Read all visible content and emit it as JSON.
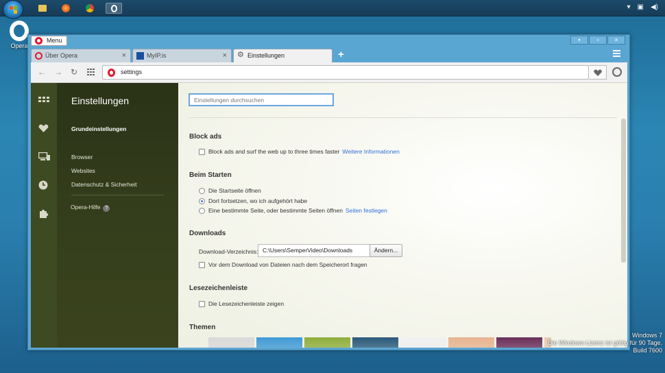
{
  "taskbar": {
    "apps": [
      {
        "name": "explorer",
        "color": "#e8c45a"
      },
      {
        "name": "firefox",
        "color": "#e35a1f"
      },
      {
        "name": "chrome",
        "color": "#4caf50"
      },
      {
        "name": "opera",
        "color": "#ffffff"
      }
    ]
  },
  "desktop": {
    "icon_label": "Opera"
  },
  "window": {
    "menu_label": "Menu",
    "controls": {
      "minimize": "▪",
      "maximize": "▫",
      "close": "×"
    }
  },
  "tabs": [
    {
      "label": "Über Opera",
      "close": "×"
    },
    {
      "label": "MyIP.is",
      "close": "×"
    },
    {
      "label": "Einstellungen",
      "close": ""
    }
  ],
  "newtab_label": "+",
  "navbar": {
    "back": "←",
    "forward": "→",
    "reload": "↻",
    "address": "settings"
  },
  "sidebar_nav": {
    "title": "Einstellungen",
    "items": [
      "Grundeinstellungen",
      "Browser",
      "Websites",
      "Datenschutz & Sicherheit"
    ],
    "help": "Opera-Hilfe",
    "help_badge": "?"
  },
  "settings": {
    "search_placeholder": "Einstellungen durchsuchen",
    "block_ads": {
      "title": "Block ads",
      "checkbox": "Block ads and surf the web up to three times faster",
      "link": "Weitere Informationen"
    },
    "startup": {
      "title": "Beim Starten",
      "options": [
        "Die Startseite öffnen",
        "Dort fortsetzen, wo ich aufgehört habe",
        "Eine bestimmte Seite, oder bestimmte Seiten öffnen"
      ],
      "link": "Seiten festlegen",
      "selected_index": 1
    },
    "downloads": {
      "title": "Downloads",
      "dir_label": "Download-Verzeichnis:",
      "dir_value": "C:\\Users\\SemperVideo\\Downloads",
      "change_button": "Ändern...",
      "ask_checkbox": "Vor dem Download von Dateien nach dem Speicherort fragen"
    },
    "bookmarks_bar": {
      "title": "Lesezeichenleiste",
      "checkbox": "Die Lesezeichenleiste zeigen"
    },
    "themes": {
      "title": "Themen",
      "thumb_colors": [
        "#d9d9d9",
        "#3f9ad6",
        "#8fae3c",
        "#2a5a7a",
        "#f0f0f0",
        "#e7b48f",
        "#6a2e5a",
        "#e8c9b0"
      ]
    }
  },
  "watermark": {
    "line1": "Windows 7",
    "line2": "Die Windows-Lizenz ist gültig für 90 Tage.",
    "line3": "Build 7600"
  }
}
